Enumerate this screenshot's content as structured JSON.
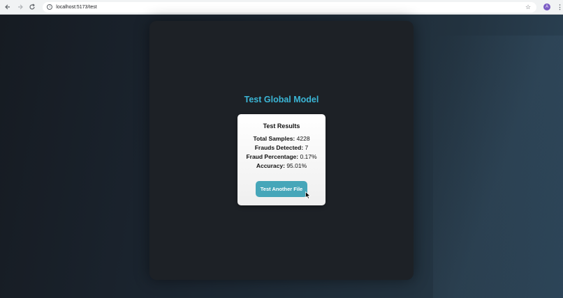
{
  "browser": {
    "url": "localhost:5173/test",
    "avatar_letter": "A"
  },
  "main": {
    "title": "Test Global Model",
    "card": {
      "title": "Test Results",
      "stats": [
        {
          "label": "Total Samples:",
          "value": "4228"
        },
        {
          "label": "Frauds Detected:",
          "value": "7"
        },
        {
          "label": "Fraud Percentage:",
          "value": "0.17%"
        },
        {
          "label": "Accuracy:",
          "value": "95.01%"
        }
      ],
      "button_label": "Test Another File"
    }
  },
  "colors": {
    "accent": "#3bb6d6",
    "button": "#46a6b9",
    "avatar": "#7b5cc4"
  },
  "icons": [
    "back-arrow-icon",
    "forward-arrow-icon",
    "reload-icon",
    "site-info-icon",
    "bookmark-star-icon",
    "more-menu-icon",
    "mouse-cursor-icon"
  ]
}
